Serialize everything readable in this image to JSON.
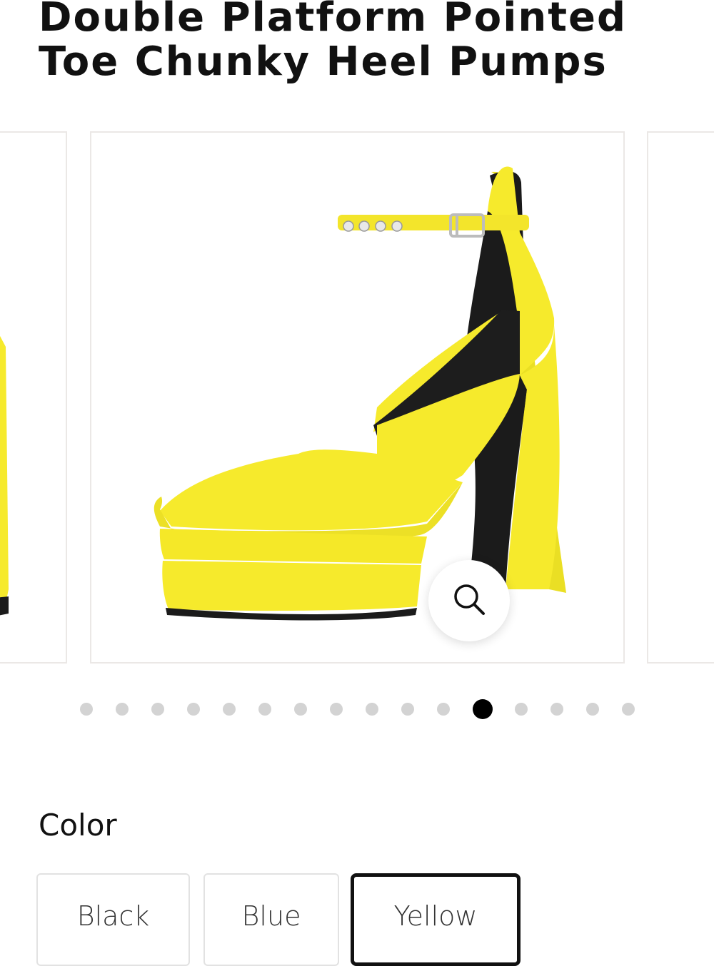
{
  "product": {
    "title": "Double Platform Pointed Toe Chunky Heel Pumps"
  },
  "gallery": {
    "image_count": 16,
    "active_index": 11,
    "zoom_icon": "search-icon",
    "product_color": "#f6ea2c"
  },
  "color_selector": {
    "label": "Color",
    "options": [
      "Black",
      "Blue",
      "Yellow"
    ],
    "selected": "Yellow"
  }
}
